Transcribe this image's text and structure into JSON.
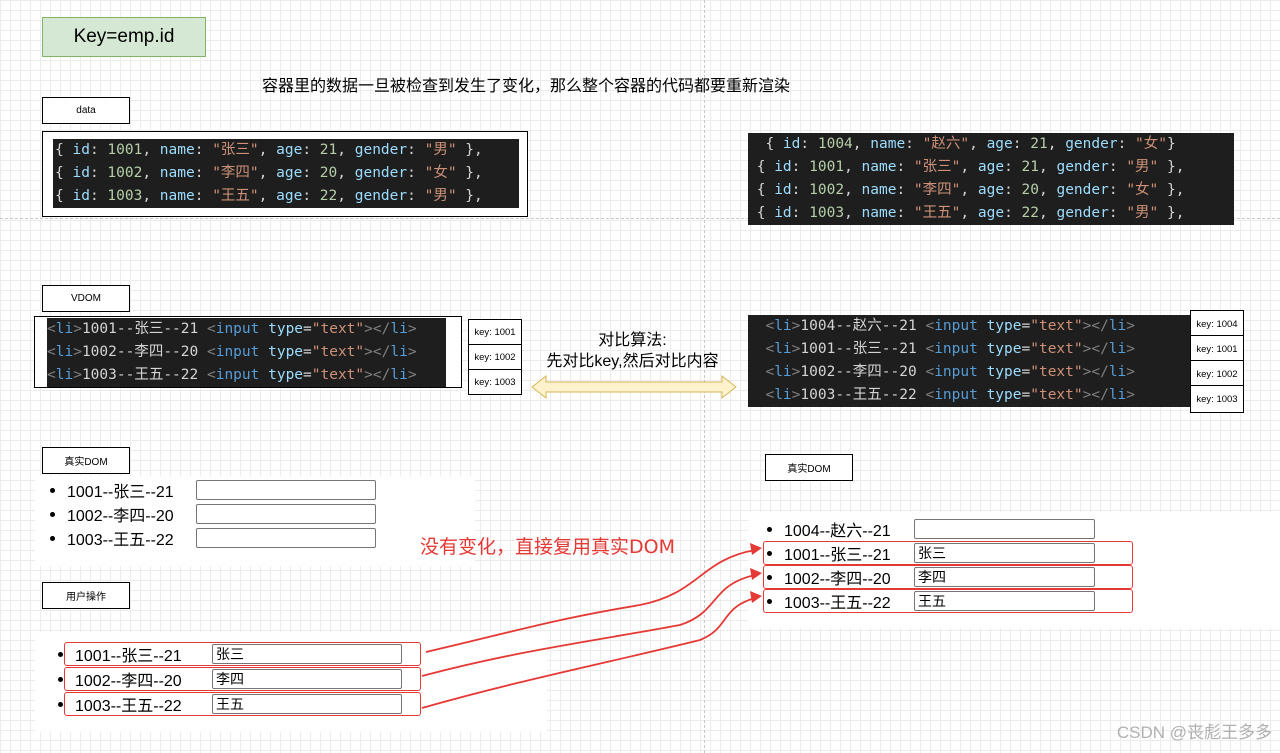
{
  "title": "Key=emp.id",
  "headline": "容器里的数据一旦被检查到发生了变化，那么整个容器的代码都要重新渲染",
  "labels": {
    "data": "data",
    "vdom": "VDOM",
    "real_dom_left": "真实DOM",
    "real_dom_right": "真实DOM",
    "user_action": "用户操作"
  },
  "data_left": [
    {
      "id": "1001",
      "name": "\"张三\"",
      "age": "21",
      "gender": "\"男\""
    },
    {
      "id": "1002",
      "name": "\"李四\"",
      "age": "20",
      "gender": "\"女\""
    },
    {
      "id": "1003",
      "name": "\"王五\"",
      "age": "22",
      "gender": "\"男\""
    }
  ],
  "data_right": [
    {
      "id": "1004",
      "name": "\"赵六\"",
      "age": "21",
      "gender": "\"女\""
    },
    {
      "id": "1001",
      "name": "\"张三\"",
      "age": "21",
      "gender": "\"男\""
    },
    {
      "id": "1002",
      "name": "\"李四\"",
      "age": "20",
      "gender": "\"女\""
    },
    {
      "id": "1003",
      "name": "\"王五\"",
      "age": "22",
      "gender": "\"男\""
    }
  ],
  "vdom_left": [
    "1001--张三--21",
    "1002--李四--20",
    "1003--王五--22"
  ],
  "vdom_right": [
    "1004--赵六--21",
    "1001--张三--21",
    "1002--李四--20",
    "1003--王五--22"
  ],
  "key_tags_left": [
    "key: 1001",
    "key: 1002",
    "key: 1003"
  ],
  "key_tags_right": [
    "key: 1004",
    "key: 1001",
    "key: 1002",
    "key: 1003"
  ],
  "compare": {
    "line1": "对比算法:",
    "line2": "先对比key,然后对比内容"
  },
  "real_dom_left": [
    {
      "label": "1001--张三--21",
      "value": ""
    },
    {
      "label": "1002--李四--20",
      "value": ""
    },
    {
      "label": "1003--王五--22",
      "value": ""
    }
  ],
  "user_action_rows": [
    {
      "label": "1001--张三--21",
      "value": "张三"
    },
    {
      "label": "1002--李四--20",
      "value": "李四"
    },
    {
      "label": "1003--王五--22",
      "value": "王五"
    }
  ],
  "real_dom_right": [
    {
      "label": "1004--赵六--21",
      "value": ""
    },
    {
      "label": "1001--张三--21",
      "value": "张三"
    },
    {
      "label": "1002--李四--20",
      "value": "李四"
    },
    {
      "label": "1003--王五--22",
      "value": "王五"
    }
  ],
  "reuse_note": "没有变化，直接复用真实DOM",
  "watermark": "CSDN @丧彪王多多",
  "colors": {
    "red": "#e53935",
    "green_fill": "#d5e8d4",
    "arrow_fill": "#fff2cc"
  }
}
